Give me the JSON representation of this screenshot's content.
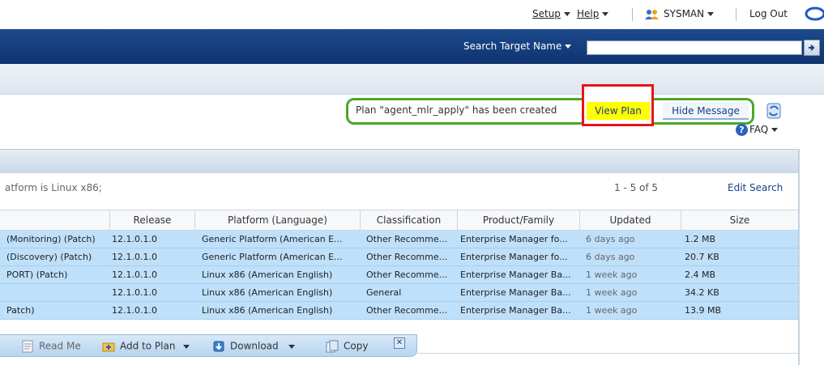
{
  "global": {
    "setup": "Setup",
    "help": "Help",
    "user": "SYSMAN",
    "logout": "Log Out"
  },
  "search": {
    "label": "Search Target Name",
    "placeholder": ""
  },
  "message": {
    "text": "Plan \"agent_mlr_apply\" has been created",
    "view_plan": "View Plan",
    "hide": "Hide Message"
  },
  "faq": "FAQ",
  "results": {
    "criteria": "atform is Linux x86;",
    "count": "1 - 5 of 5",
    "edit_search": "Edit Search",
    "columns": [
      "Release",
      "Platform (Language)",
      "Classification",
      "Product/Family",
      "Updated",
      "Size"
    ],
    "rows": [
      {
        "name": "(Monitoring) (Patch)",
        "release": "12.1.0.1.0",
        "platform": "Generic Platform (American E...",
        "classification": "Other Recomme...",
        "product": "Enterprise Manager fo...",
        "updated": "6 days ago",
        "size": "1.2 MB"
      },
      {
        "name": "(Discovery) (Patch)",
        "release": "12.1.0.1.0",
        "platform": "Generic Platform (American E...",
        "classification": "Other Recomme...",
        "product": "Enterprise Manager fo...",
        "updated": "6 days ago",
        "size": "20.7 KB"
      },
      {
        "name": "PORT) (Patch)",
        "release": "12.1.0.1.0",
        "platform": "Linux x86 (American English)",
        "classification": "Other Recomme...",
        "product": "Enterprise Manager Ba...",
        "updated": "1 week ago",
        "size": "2.4 MB"
      },
      {
        "name": "",
        "release": "12.1.0.1.0",
        "platform": "Linux x86 (American English)",
        "classification": "General",
        "product": "Enterprise Manager Ba...",
        "updated": "1 week ago",
        "size": "34.2 KB"
      },
      {
        "name": "Patch)",
        "release": "12.1.0.1.0",
        "platform": "Linux x86 (American English)",
        "classification": "Other Recomme...",
        "product": "Enterprise Manager Ba...",
        "updated": "1 week ago",
        "size": "13.9 MB"
      }
    ]
  },
  "toolbar": {
    "read_me": "Read Me",
    "add_to_plan": "Add to Plan",
    "download": "Download",
    "copy": "Copy"
  },
  "colors": {
    "brand_blue": "#0f3470",
    "row_highlight": "#bfe0fb",
    "callout_green": "#4aa62c",
    "callout_red": "#e8131b",
    "view_plan_yellow": "#ffff00"
  },
  "icons": [
    "user-icon",
    "oracle-logo-icon",
    "search-go-icon",
    "refresh-icon",
    "help-icon",
    "read-me-icon",
    "add-to-plan-icon",
    "download-icon",
    "copy-icon",
    "close-icon"
  ]
}
